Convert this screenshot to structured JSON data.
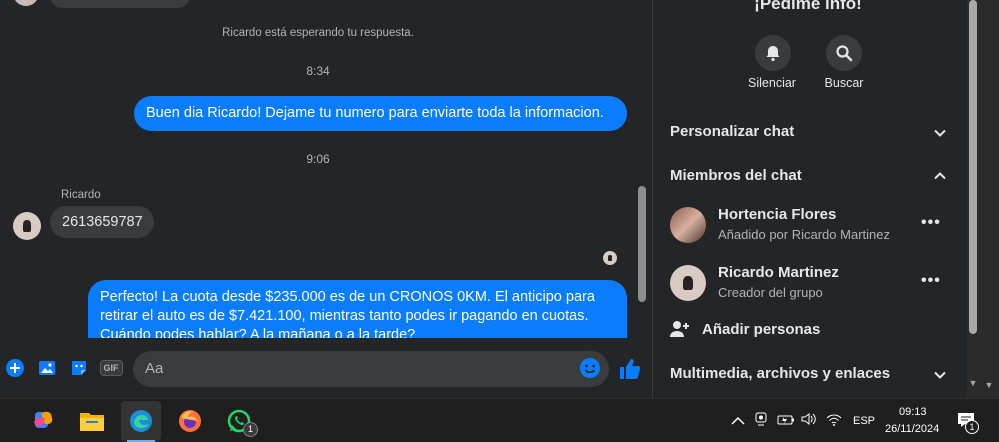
{
  "chat": {
    "system_message": "Ricardo está esperando tu respuesta.",
    "time_1": "8:34",
    "outgoing_1": "Buen dia Ricardo! Dejame tu numero para enviarte toda la informacion.",
    "time_2": "9:06",
    "sender_name": "Ricardo",
    "incoming_1": "2613659787",
    "outgoing_2_line1": "Perfecto! La cuota desde $235.000 es de un CRONOS 0KM. El anticipo para",
    "outgoing_2_line2": "retirar el auto es de $7.421.100, mientras tanto podes ir pagando en cuotas.",
    "outgoing_2_line3": "Cuándo podes hablar? A la mañana o a la tarde?"
  },
  "composer": {
    "placeholder": "Aa",
    "icons": [
      "plus-circle-icon",
      "gallery-icon",
      "sticker-icon",
      "gif-icon",
      "emoji-icon",
      "thumbs-up-icon"
    ],
    "gif_label": "GIF"
  },
  "panel": {
    "title": "¡Pedime info!",
    "actions": [
      {
        "label": "Silenciar",
        "icon": "bell-icon"
      },
      {
        "label": "Buscar",
        "icon": "search-icon"
      }
    ],
    "customize_label": "Personalizar chat",
    "members_label": "Miembros del chat",
    "members": [
      {
        "name": "Hortencia Flores",
        "subtitle": "Añadido por Ricardo Martinez"
      },
      {
        "name": "Ricardo Martinez",
        "subtitle": "Creador del grupo"
      }
    ],
    "add_people_label": "Añadir personas",
    "media_label": "Multimedia, archivos y enlaces",
    "more_dots": "•••"
  },
  "taskbar": {
    "apps": [
      "copilot-icon",
      "file-explorer-icon",
      "edge-icon",
      "firefox-icon",
      "whatsapp-icon"
    ],
    "whatsapp_badge": "1",
    "language": "ESP",
    "time": "09:13",
    "date": "26/11/2024",
    "notification_count": "1"
  },
  "colors": {
    "accent": "#0a7cff",
    "background": "#242526",
    "bubble_incoming": "#3a3b3c"
  }
}
